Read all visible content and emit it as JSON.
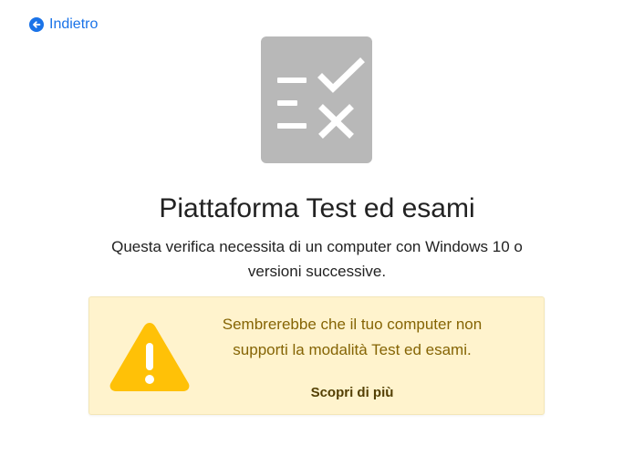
{
  "nav": {
    "back_label": "Indietro"
  },
  "main": {
    "title": "Piattaforma Test ed esami",
    "subtitle": "Questa verifica necessita di un computer con Windows 10 o versioni successive."
  },
  "warning": {
    "message": "Sembrerebbe che il tuo computer non supporti la modalità Test ed esami.",
    "link_label": "Scopri di più"
  },
  "colors": {
    "link": "#1a73e8",
    "icon_bg": "#b8b8b8",
    "warning_bg": "#fff3cd",
    "warning_text": "#856404",
    "warning_icon": "#ffc107"
  },
  "icons": {
    "back": "arrow-left-circle-icon",
    "hero": "checklist-icon",
    "warning": "warning-triangle-icon"
  }
}
